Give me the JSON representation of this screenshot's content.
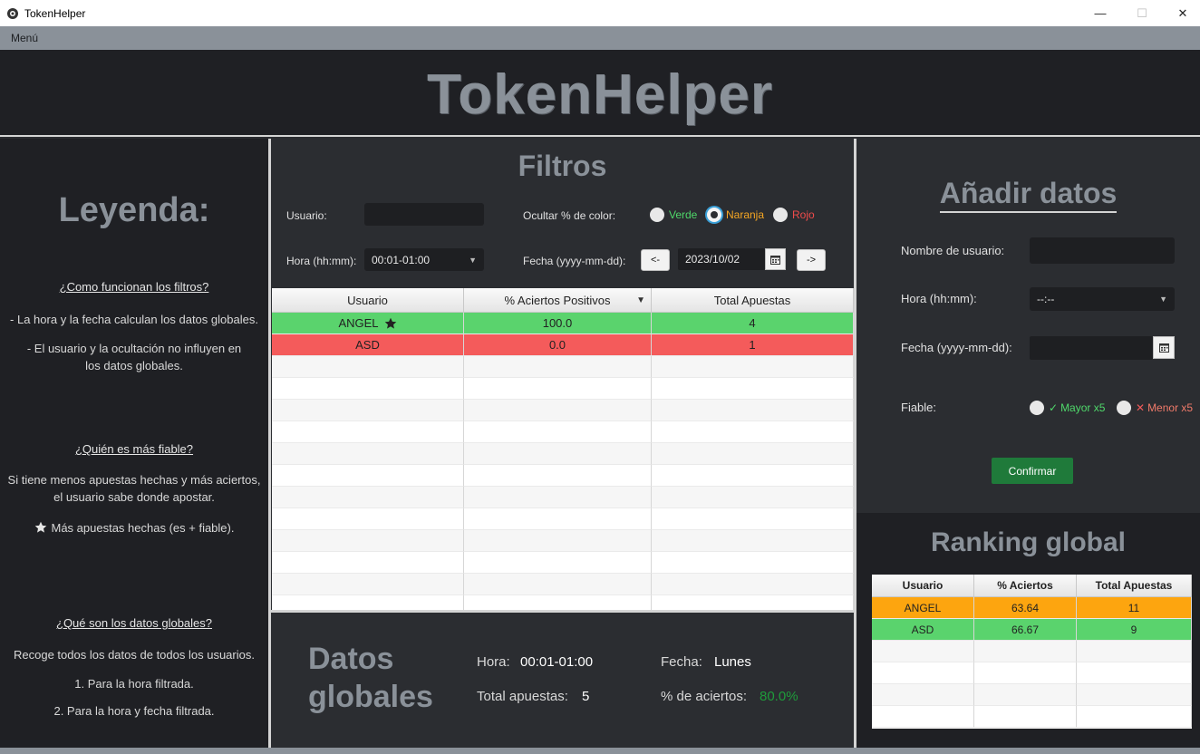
{
  "window": {
    "title": "TokenHelper",
    "minimize": "—",
    "maximize": "☐",
    "close": "✕"
  },
  "menubar": {
    "menu": "Menú"
  },
  "header": {
    "brand": "TokenHelper"
  },
  "legend": {
    "title": "Leyenda:",
    "q1": "¿Como funcionan los filtros?",
    "q1_line1": "- La hora y la fecha calculan los datos globales.",
    "q1_line2": "- El usuario y la ocultación no influyen en",
    "q1_line3": "los datos globales.",
    "q2": "¿Quién es más fiable?",
    "q2_line1": "Si tiene menos apuestas hechas y más aciertos,",
    "q2_line2": "el usuario sabe donde apostar.",
    "q2_line3": "Más apuestas hechas (es + fiable).",
    "q3": "¿Qué son los datos globales?",
    "q3_line1": "Recoge todos los datos de todos los usuarios.",
    "q3_line2": "1. Para la hora filtrada.",
    "q3_line3": "2. Para la hora y fecha filtrada."
  },
  "filters": {
    "title": "Filtros",
    "user_label": "Usuario:",
    "user_value": "",
    "hide_label": "Ocultar % de color:",
    "radio_green": "Verde",
    "radio_orange": "Naranja",
    "radio_red": "Rojo",
    "selected_color": "Naranja",
    "hour_label": "Hora (hh:mm):",
    "hour_value": "00:01-01:00",
    "date_label": "Fecha (yyyy-mm-dd):",
    "prev_button": "<-",
    "date_value": "2023/10/02",
    "next_button": "->"
  },
  "table": {
    "columns": [
      "Usuario",
      "% Aciertos Positivos",
      "Total Apuestas"
    ],
    "rows": [
      {
        "user": "ANGEL",
        "pct": "100.0",
        "total": "4",
        "color": "#5ad36d",
        "starred": true
      },
      {
        "user": "ASD",
        "pct": "0.0",
        "total": "1",
        "color": "#f45b5b",
        "starred": false
      }
    ],
    "sort_column": "% Aciertos Positivos"
  },
  "global": {
    "title_line1": "Datos",
    "title_line2": "globales",
    "hour_label": "Hora:",
    "hour_value": "00:01-01:00",
    "date_label": "Fecha:",
    "date_value": "Lunes",
    "bets_label": "Total apuestas:",
    "bets_value": "5",
    "pct_label": "% de aciertos:",
    "pct_value": "80.0%"
  },
  "add": {
    "title": "Añadir datos",
    "user_label": "Nombre de usuario:",
    "user_value": "",
    "hour_label": "Hora (hh:mm):",
    "hour_value": "--:--",
    "date_label": "Fecha (yyyy-mm-dd):",
    "date_value": "",
    "reliable_label": "Fiable:",
    "opt_major": "Mayor x5",
    "opt_minor": "Menor x5",
    "confirm_button": "Confirmar"
  },
  "ranking": {
    "title": "Ranking global",
    "columns": [
      "Usuario",
      "% Aciertos",
      "Total Apuestas"
    ],
    "rows": [
      {
        "user": "ANGEL",
        "pct": "63.64",
        "total": "11",
        "color": "#fda50f"
      },
      {
        "user": "ASD",
        "pct": "66.67",
        "total": "9",
        "color": "#5ad36d"
      }
    ]
  },
  "colors": {
    "green_text": "#4fd86a",
    "orange_text": "#f5a623",
    "red_text": "#f04b4b",
    "pct_green": "#1f9c3b"
  }
}
